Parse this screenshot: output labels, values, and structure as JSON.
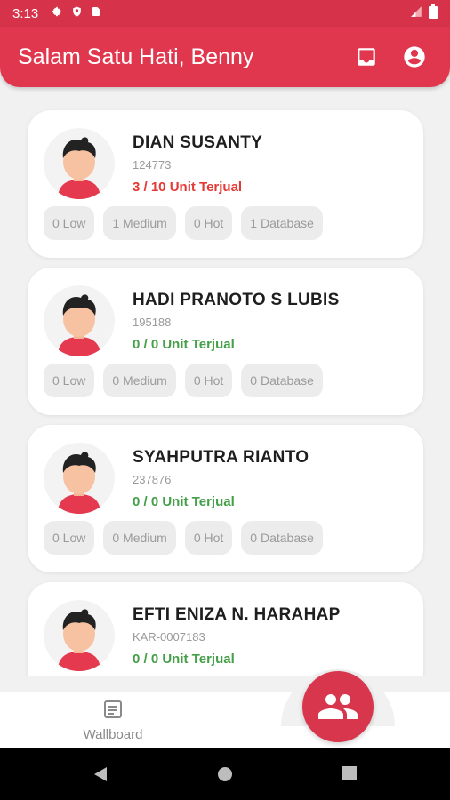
{
  "status_bar": {
    "time": "3:13"
  },
  "app_bar": {
    "title": "Salam Satu Hati, Benny"
  },
  "cards": [
    {
      "name": "DIAN SUSANTY",
      "code": "124773",
      "sold": "3 / 10 Unit Terjual",
      "sold_color": "#e53935",
      "chips": [
        "0 Low",
        "1 Medium",
        "0 Hot",
        "1 Database"
      ]
    },
    {
      "name": "HADI PRANOTO S LUBIS",
      "code": "195188",
      "sold": "0 / 0 Unit Terjual",
      "sold_color": "#43a047",
      "chips": [
        "0 Low",
        "0 Medium",
        "0 Hot",
        "0 Database"
      ]
    },
    {
      "name": "SYAHPUTRA RIANTO",
      "code": "237876",
      "sold": "0 / 0 Unit Terjual",
      "sold_color": "#43a047",
      "chips": [
        "0 Low",
        "0 Medium",
        "0 Hot",
        "0 Database"
      ]
    },
    {
      "name": "EFTI ENIZA N. HARAHAP",
      "code": "KAR-0007183",
      "sold": "0 / 0 Unit Terjual",
      "sold_color": "#43a047",
      "chips": []
    }
  ],
  "bottom_nav": {
    "wallboard_label": "Wallboard",
    "fab_icon": "people-icon"
  },
  "colors": {
    "primary": "#e0374e",
    "sold_red": "#e53935",
    "sold_green": "#43a047"
  }
}
